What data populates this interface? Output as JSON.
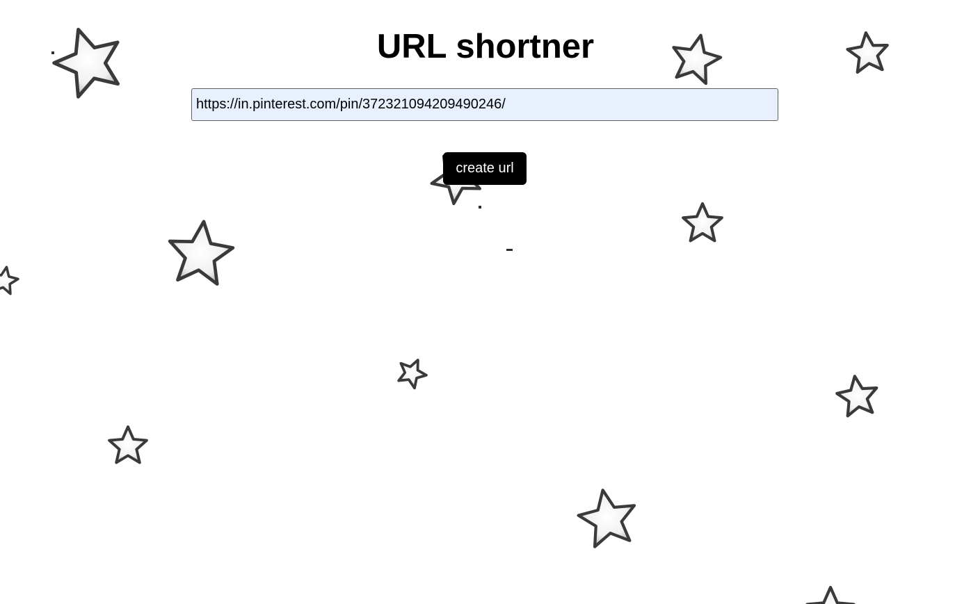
{
  "page": {
    "title": "URL shortner"
  },
  "form": {
    "url_value": "https://in.pinterest.com/pin/372321094209490246/",
    "submit_label": "create url"
  },
  "background": {
    "decoration": "star-icon",
    "star_fill": "#f4f4f4",
    "star_outline": "#3a3a3a"
  }
}
